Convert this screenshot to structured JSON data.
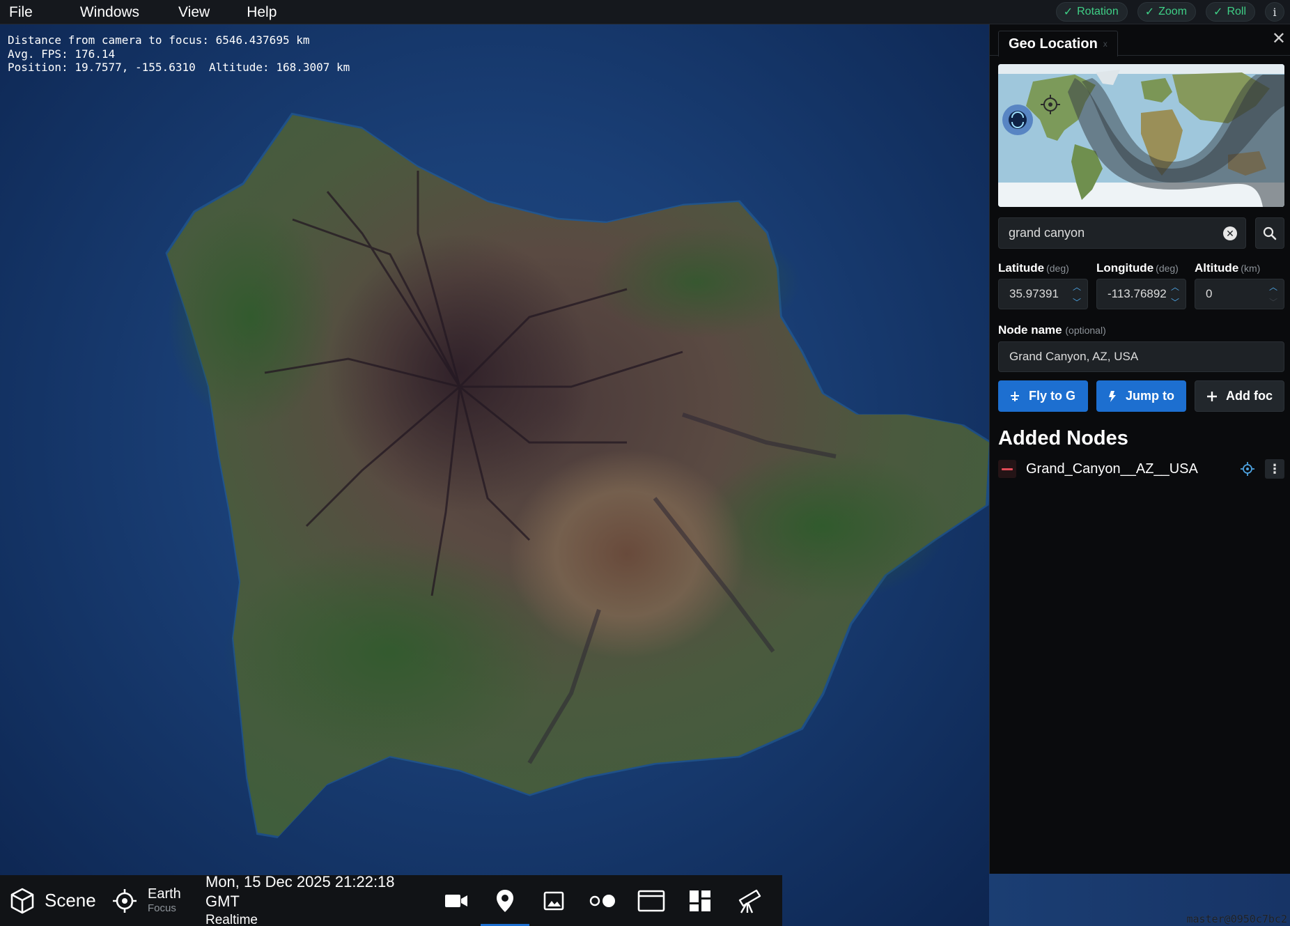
{
  "menu": {
    "items": [
      "File",
      "Windows",
      "View",
      "Help"
    ]
  },
  "toggles": [
    {
      "label": "Rotation",
      "checked": true
    },
    {
      "label": "Zoom",
      "checked": true
    },
    {
      "label": "Roll",
      "checked": true
    }
  ],
  "info_icon": "i",
  "hud": {
    "line1": "Distance from camera to focus: 6546.437695 km",
    "line2": "Avg. FPS: 176.14",
    "line3": "Position: 19.7577, -155.6310  Altitude: 168.3007 km"
  },
  "version": "master@0950c7bc2",
  "panel": {
    "tab_title": "Geo Location",
    "tab_close": "x",
    "close_icon": "✕",
    "search": {
      "value": "grand canyon"
    },
    "latitude": {
      "label": "Latitude",
      "unit": "(deg)",
      "value": "35.97391"
    },
    "longitude": {
      "label": "Longitude",
      "unit": "(deg)",
      "value": "-113.76892"
    },
    "altitude": {
      "label": "Altitude",
      "unit": "(km)",
      "value": "0"
    },
    "node_name": {
      "label": "Node name",
      "unit": "(optional)",
      "value": "Grand Canyon, AZ, USA"
    },
    "buttons": {
      "fly": "Fly to G",
      "jump": "Jump to",
      "add": "Add foc"
    },
    "added_title": "Added Nodes",
    "nodes": [
      {
        "name": "Grand_Canyon__AZ__USA"
      }
    ]
  },
  "bottom": {
    "scene_label": "Scene",
    "focus_name": "Earth",
    "focus_sub": "Focus",
    "time": "Mon, 15 Dec 2025 21:22:18 GMT",
    "time_mode": "Realtime",
    "active_tool": "geo-location"
  },
  "colors": {
    "accent": "#1d6fd0",
    "toggle_green": "#3fcf86",
    "remove_red": "#e04b57"
  }
}
